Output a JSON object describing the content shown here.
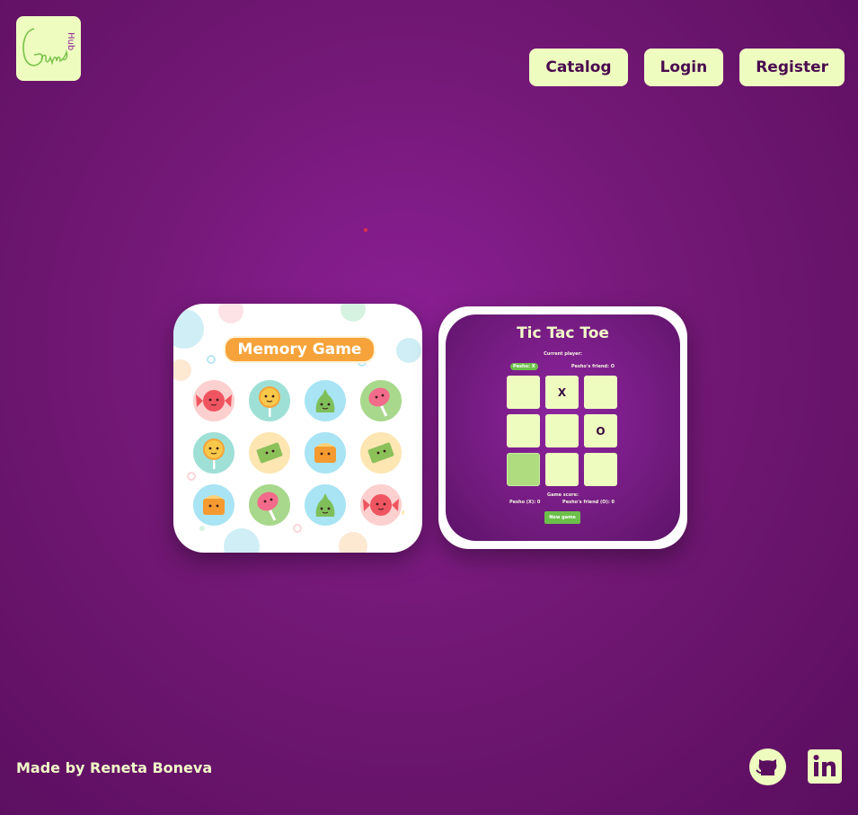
{
  "header": {
    "logo": {
      "text": "Game",
      "sub": "Hub",
      "icon": "game-hub-logo"
    },
    "nav": [
      {
        "label": "Catalog"
      },
      {
        "label": "Login"
      },
      {
        "label": "Register"
      }
    ]
  },
  "catalog": {
    "memory_game": {
      "title": "Memory Game",
      "tiles": [
        "candy-icon",
        "lollipop-icon",
        "pouch-candy-icon",
        "popsicle-icon",
        "lollipop-icon",
        "wrapped-candy-icon",
        "cake-icon",
        "wrapped-candy-icon",
        "cake-icon",
        "popsicle-icon",
        "pouch-candy-icon",
        "candy-icon"
      ]
    },
    "tic_tac_toe": {
      "title": "Tic Tac Toe",
      "current_player_label": "Current player:",
      "current_player_badge": "Pesho: X",
      "friend_label": "Pesho's friend: O",
      "board": [
        "",
        "X",
        "",
        "",
        "",
        "O",
        "",
        "",
        ""
      ],
      "highlighted_cell": 6,
      "score_label": "Game score:",
      "score_x": "Pesho (X): 0",
      "score_o": "Pesho's friend (O): 0",
      "new_game": "New game"
    }
  },
  "footer": {
    "credit": "Made by Reneta Boneva",
    "links": [
      {
        "icon": "github-icon"
      },
      {
        "icon": "linkedin-icon"
      }
    ]
  },
  "colors": {
    "background": "#7a1a82",
    "accent": "#eefcc0",
    "text_dark": "#4a0a4f",
    "button_green": "#6cc04a"
  }
}
